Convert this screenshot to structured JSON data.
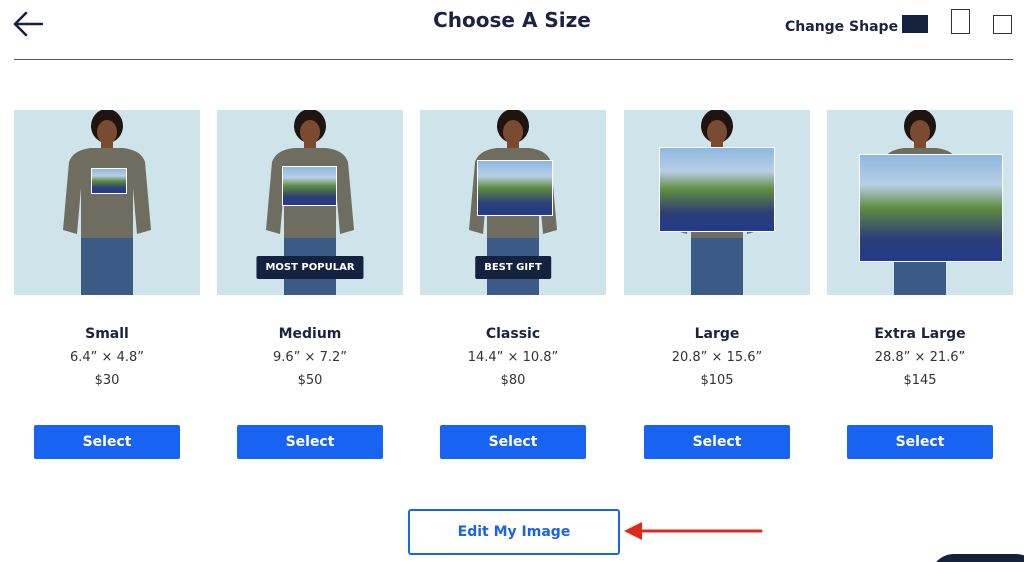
{
  "header": {
    "title": "Choose A Size",
    "change_shape_label": "Change Shape",
    "shapes": [
      "landscape",
      "portrait",
      "square"
    ],
    "active_shape": "landscape"
  },
  "sizes": [
    {
      "name": "Small",
      "dims": "6.4” × 4.8”",
      "price": "$30",
      "badge": "",
      "select_label": "Select"
    },
    {
      "name": "Medium",
      "dims": "9.6” × 7.2”",
      "price": "$50",
      "badge": "MOST POPULAR",
      "select_label": "Select"
    },
    {
      "name": "Classic",
      "dims": "14.4” × 10.8”",
      "price": "$80",
      "badge": "BEST GIFT",
      "select_label": "Select"
    },
    {
      "name": "Large",
      "dims": "20.8” × 15.6”",
      "price": "$105",
      "badge": "",
      "select_label": "Select"
    },
    {
      "name": "Extra Large",
      "dims": "28.8” × 21.6”",
      "price": "$145",
      "badge": "",
      "select_label": "Select"
    }
  ],
  "edit_button_label": "Edit My Image",
  "colors": {
    "navy": "#15223f",
    "primary": "#1963f2",
    "annotation": "#e0281f",
    "photo_bg": "#cfe3ea"
  }
}
